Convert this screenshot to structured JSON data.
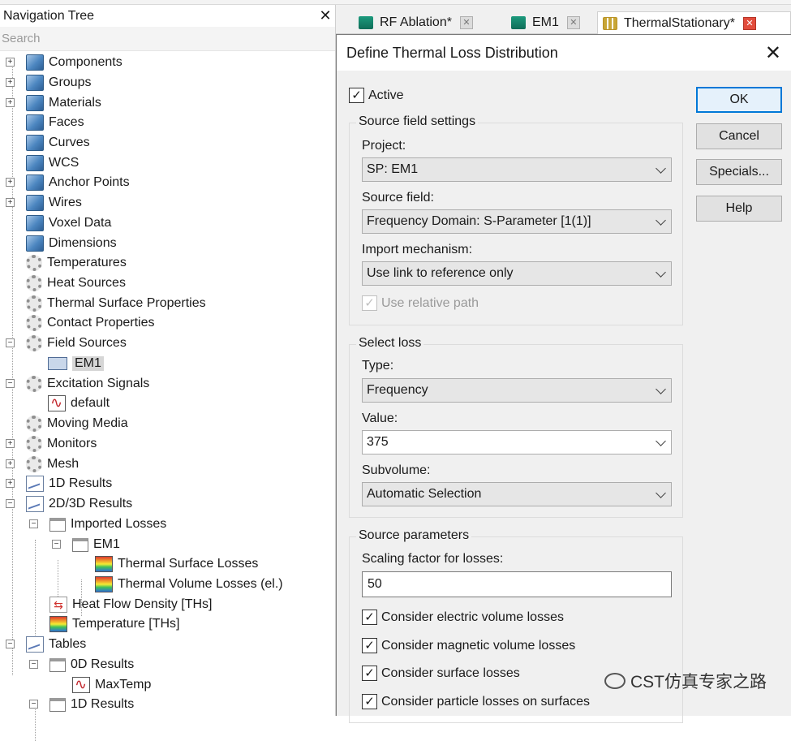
{
  "nav": {
    "title": "Navigation Tree",
    "search_placeholder": "Search",
    "items": [
      {
        "label": "Components"
      },
      {
        "label": "Groups"
      },
      {
        "label": "Materials"
      },
      {
        "label": "Faces"
      },
      {
        "label": "Curves"
      },
      {
        "label": "WCS"
      },
      {
        "label": "Anchor Points"
      },
      {
        "label": "Wires"
      },
      {
        "label": "Voxel Data"
      },
      {
        "label": "Dimensions"
      },
      {
        "label": "Temperatures"
      },
      {
        "label": "Heat Sources"
      },
      {
        "label": "Thermal Surface Properties"
      },
      {
        "label": "Contact Properties"
      },
      {
        "label": "Field Sources"
      },
      {
        "label": "EM1"
      },
      {
        "label": "Excitation Signals"
      },
      {
        "label": "default"
      },
      {
        "label": "Moving Media"
      },
      {
        "label": "Monitors"
      },
      {
        "label": "Mesh"
      },
      {
        "label": "1D Results"
      },
      {
        "label": "2D/3D Results"
      },
      {
        "label": "Imported Losses"
      },
      {
        "label": "EM1"
      },
      {
        "label": "Thermal Surface Losses"
      },
      {
        "label": "Thermal Volume Losses (el.)"
      },
      {
        "label": "Heat Flow Density [THs]"
      },
      {
        "label": "Temperature [THs]"
      },
      {
        "label": "Tables"
      },
      {
        "label": "0D Results"
      },
      {
        "label": "MaxTemp"
      },
      {
        "label": "1D Results"
      }
    ]
  },
  "tabs": [
    {
      "label": "RF Ablation*"
    },
    {
      "label": "EM1"
    },
    {
      "label": "ThermalStationary*"
    }
  ],
  "dialog": {
    "title": "Define Thermal Loss Distribution",
    "active_label": "Active",
    "buttons": {
      "ok": "OK",
      "cancel": "Cancel",
      "specials": "Specials...",
      "help": "Help"
    },
    "source_field_settings": {
      "title": "Source field settings",
      "project_label": "Project:",
      "project_value": "SP: EM1",
      "source_field_label": "Source field:",
      "source_field_value": "Frequency Domain: S-Parameter [1(1)]",
      "import_label": "Import mechanism:",
      "import_value": "Use link to reference only",
      "relative_path_label": "Use relative path"
    },
    "select_loss": {
      "title": "Select loss",
      "type_label": "Type:",
      "type_value": "Frequency",
      "value_label": "Value:",
      "value_value": "375",
      "subvolume_label": "Subvolume:",
      "subvolume_value": "Automatic Selection"
    },
    "source_parameters": {
      "title": "Source parameters",
      "scaling_label": "Scaling factor for losses:",
      "scaling_value": "50",
      "checks": [
        {
          "label": "Consider electric volume losses"
        },
        {
          "label": "Consider magnetic volume losses"
        },
        {
          "label": "Consider surface losses"
        },
        {
          "label": "Consider particle losses on surfaces"
        }
      ]
    }
  },
  "watermark": "CST仿真专家之路"
}
